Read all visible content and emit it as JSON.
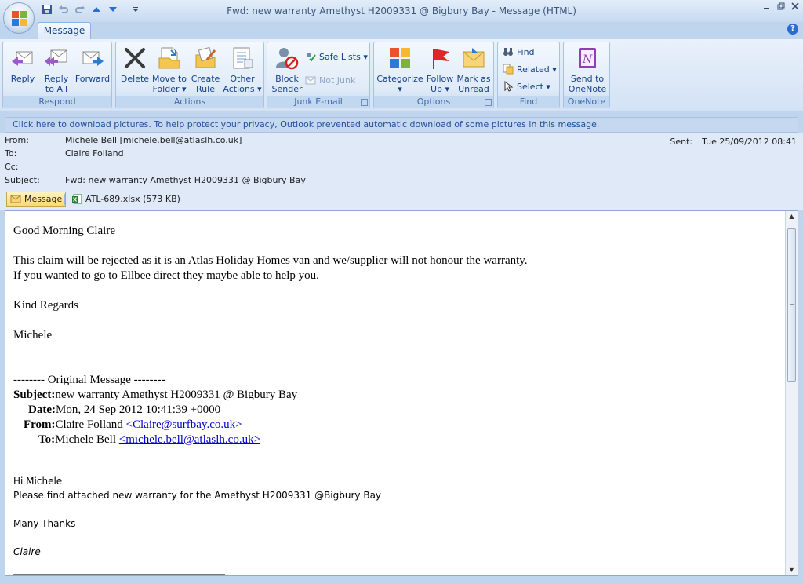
{
  "window": {
    "title": "Fwd: new warranty Amethyst H2009331 @ Bigbury Bay - Message (HTML)",
    "controls": [
      "minimize-icon",
      "restore-icon",
      "close-icon"
    ]
  },
  "quick_access": [
    "save-icon",
    "undo-icon",
    "redo-icon",
    "previous-icon",
    "next-icon",
    "customize-icon"
  ],
  "tabs": [
    {
      "label": "Message",
      "active": true
    }
  ],
  "ribbon": {
    "groups": {
      "respond": {
        "label": "Respond",
        "reply": "Reply",
        "reply_all_1": "Reply",
        "reply_all_2": "to All",
        "forward": "Forward"
      },
      "actions": {
        "label": "Actions",
        "delete": "Delete",
        "move_1": "Move to",
        "move_2": "Folder ▾",
        "rule_1": "Create",
        "rule_2": "Rule",
        "other_1": "Other",
        "other_2": "Actions ▾"
      },
      "junk": {
        "label": "Junk E-mail",
        "block_1": "Block",
        "block_2": "Sender",
        "safe_lists": "Safe Lists ▾",
        "not_junk": "Not Junk"
      },
      "options": {
        "label": "Options",
        "categorize": "Categorize",
        "categorize_arrow": "▾",
        "follow_1": "Follow",
        "follow_2": "Up ▾",
        "mark_1": "Mark as",
        "mark_2": "Unread"
      },
      "find": {
        "label": "Find",
        "find": "Find",
        "related": "Related ▾",
        "select": "Select ▾"
      },
      "onenote": {
        "label": "OneNote",
        "send_1": "Send to",
        "send_2": "OneNote"
      }
    },
    "colors": {
      "accent": "#15428b",
      "group_label": "#3e6aaa"
    }
  },
  "infobar": {
    "text": "Click here to download pictures. To help protect your privacy, Outlook prevented automatic download of some pictures in this message."
  },
  "header": {
    "from_label": "From:",
    "from_value": "Michele Bell [michele.bell@atlaslh.co.uk]",
    "to_label": "To:",
    "to_value": "Claire Folland",
    "cc_label": "Cc:",
    "cc_value": "",
    "subject_label": "Subject:",
    "subject_value": "Fwd: new warranty Amethyst H2009331 @ Bigbury Bay",
    "sent_label": "Sent:",
    "sent_value": "Tue 25/09/2012 08:41"
  },
  "attachments": [
    {
      "label": "Message",
      "icon": "envelope-icon",
      "active": true
    },
    {
      "label": "ATL-689.xlsx (573 KB)",
      "icon": "excel-icon",
      "active": false
    }
  ],
  "body": {
    "greeting": "Good Morning Claire",
    "line1": "This claim will be rejected as it is an Atlas Holiday Homes van and we/supplier will not honour the warranty.",
    "line2": "If you wanted to go to Ellbee direct they maybe able to help you.",
    "regards": "Kind Regards",
    "signoff": "Michele",
    "original_header": "-------- Original Message --------",
    "orig_subject_label": "Subject:",
    "orig_subject": "new warranty Amethyst H2009331 @ Bigbury Bay",
    "orig_date_label": "Date:",
    "orig_date": "Mon, 24 Sep 2012 10:41:39 +0000",
    "orig_from_label": "From:",
    "orig_from_name": "Claire Folland ",
    "orig_from_email": "<Claire@surfbay.co.uk>",
    "orig_to_label": "To:",
    "orig_to_name": "Michele Bell ",
    "orig_to_email": "<michele.bell@atlaslh.co.uk>",
    "q_greeting": "Hi Michele",
    "q_line": "Please find attached new warranty for the Amethyst H2009331 @Bigbury Bay",
    "q_thanks": "Many Thanks",
    "q_name": "Claire"
  }
}
